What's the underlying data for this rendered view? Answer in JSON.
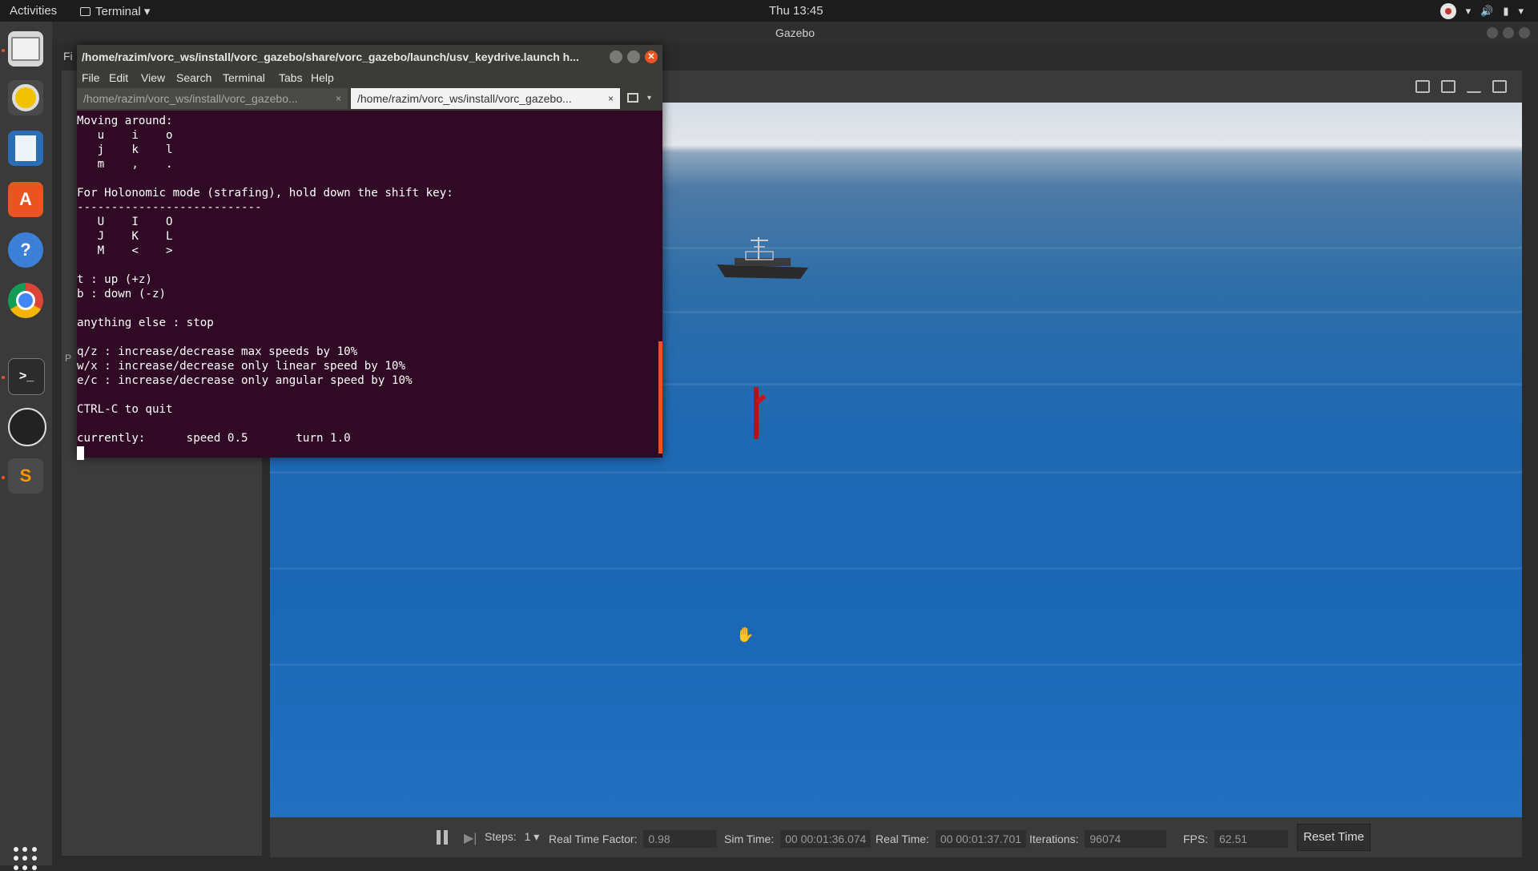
{
  "topbar": {
    "activities": "Activities",
    "app_menu": "Terminal ▾",
    "clock": "Thu 13:45",
    "tray_menu": "▾"
  },
  "dock": {
    "items": [
      "files-icon",
      "rhythmbox-icon",
      "libreoffice-writer-icon",
      "ubuntu-software-icon",
      "help-icon",
      "chrome-icon",
      "terminal-icon",
      "obs-icon",
      "sublime-text-icon"
    ],
    "accent": "#e95420"
  },
  "gazebo": {
    "title": "Gazebo",
    "menu_file": "Fi",
    "left_panel_tag": "P",
    "status": {
      "steps_label": "Steps:",
      "steps_value": "1 ▾",
      "rtf_label": "Real Time Factor:",
      "rtf_value": "0.98",
      "sim_label": "Sim Time:",
      "sim_value": "00 00:01:36.074",
      "real_label": "Real Time:",
      "real_value": "00 00:01:37.701",
      "iter_label": "Iterations:",
      "iter_value": "96074",
      "fps_label": "FPS:",
      "fps_value": "62.51",
      "reset_label": "Reset Time"
    }
  },
  "terminal": {
    "title": "/home/razim/vorc_ws/install/vorc_gazebo/share/vorc_gazebo/launch/usv_keydrive.launch h...",
    "menu": [
      "File",
      "Edit",
      "View",
      "Search",
      "Terminal",
      "Tabs",
      "Help"
    ],
    "tabs": [
      {
        "label": "/home/razim/vorc_ws/install/vorc_gazebo...",
        "close": "×"
      },
      {
        "label": "/home/razim/vorc_ws/install/vorc_gazebo...",
        "close": "×"
      }
    ],
    "tab_menu": "▾",
    "lines": [
      "Moving around:",
      "   u    i    o",
      "   j    k    l",
      "   m    ,    .",
      "",
      "For Holonomic mode (strafing), hold down the shift key:",
      "---------------------------",
      "   U    I    O",
      "   J    K    L",
      "   M    <    >",
      "",
      "t : up (+z)",
      "b : down (-z)",
      "",
      "anything else : stop",
      "",
      "q/z : increase/decrease max speeds by 10%",
      "w/x : increase/decrease only linear speed by 10%",
      "e/c : increase/decrease only angular speed by 10%",
      "",
      "CTRL-C to quit",
      "",
      "currently:      speed 0.5       turn 1.0"
    ]
  }
}
